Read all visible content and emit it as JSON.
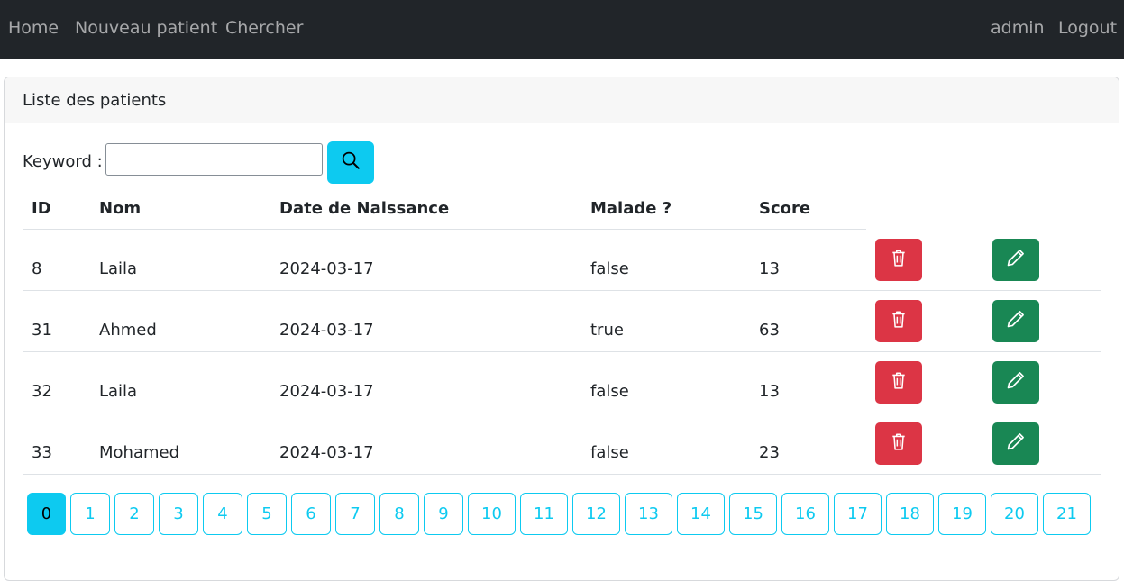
{
  "navbar": {
    "left_links": [
      "Home",
      "Nouveau patient",
      "Chercher"
    ],
    "right_links": [
      "admin",
      "Logout"
    ]
  },
  "card": {
    "title": "Liste des patients"
  },
  "search": {
    "label": "Keyword :",
    "value": "",
    "icon": "search-icon"
  },
  "table": {
    "headers": [
      "ID",
      "Nom",
      "Date de Naissance",
      "Malade ?",
      "Score"
    ],
    "rows": [
      [
        "8",
        "Laila",
        "2024-03-17",
        "false",
        "13"
      ],
      [
        "31",
        "Ahmed",
        "2024-03-17",
        "true",
        "63"
      ],
      [
        "32",
        "Laila",
        "2024-03-17",
        "false",
        "13"
      ],
      [
        "33",
        "Mohamed",
        "2024-03-17",
        "false",
        "23"
      ]
    ],
    "delete_icon": "trash-icon",
    "edit_icon": "pencil-icon"
  },
  "pagination": {
    "pages": [
      "0",
      "1",
      "2",
      "3",
      "4",
      "5",
      "6",
      "7",
      "8",
      "9",
      "10",
      "11",
      "12",
      "13",
      "14",
      "15",
      "16",
      "17",
      "18",
      "19",
      "20",
      "21"
    ],
    "current": "0"
  },
  "colors": {
    "navbar": "#212529",
    "info": "#0dcaf0",
    "danger": "#dc3545",
    "success": "#198754"
  }
}
